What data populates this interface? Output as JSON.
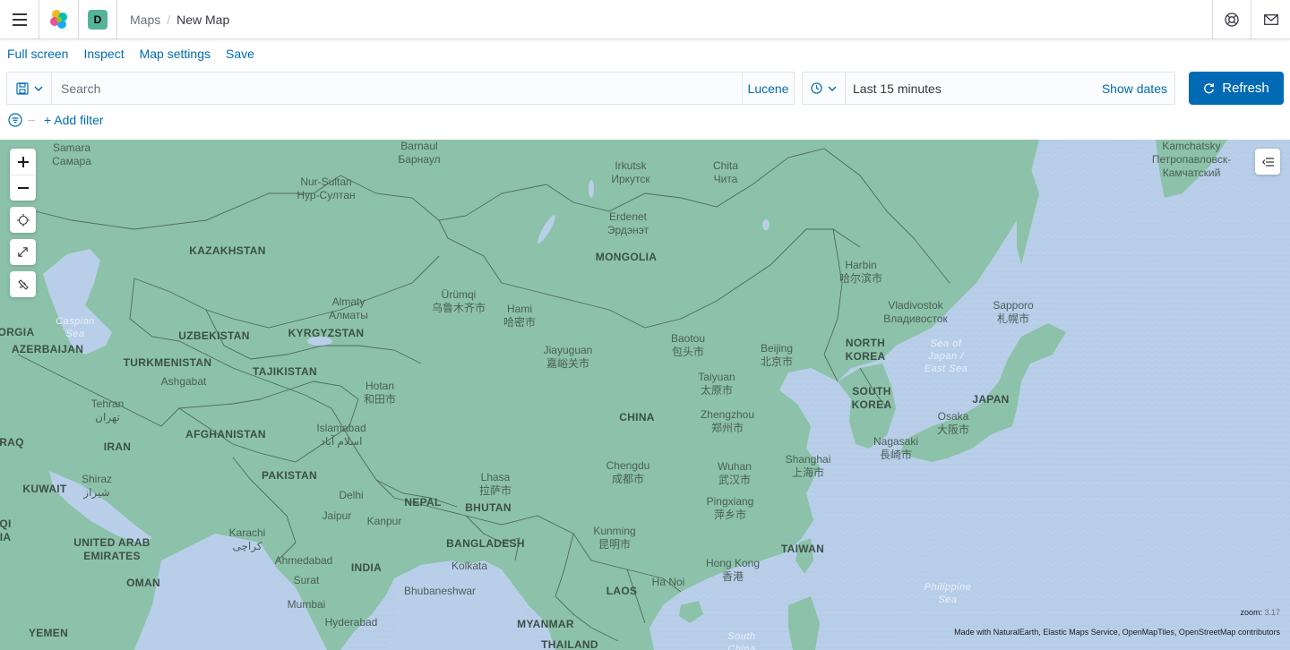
{
  "header": {
    "space_initial": "D",
    "breadcrumbs": [
      "Maps",
      "New Map"
    ]
  },
  "topnav": [
    "Full screen",
    "Inspect",
    "Map settings",
    "Save"
  ],
  "query": {
    "placeholder": "Search",
    "language": "Lucene"
  },
  "date": {
    "range": "Last 15 minutes",
    "show_dates": "Show dates",
    "refresh": "Refresh"
  },
  "filter": {
    "add": "+ Add filter"
  },
  "map": {
    "zoom_label": "zoom:",
    "zoom_value": "3.17",
    "attribution": "Made with NaturalEarth, Elastic Maps Service, OpenMapTiles, OpenStreetMap contributors",
    "colors": {
      "land": "#8cc2a9",
      "water": "#b9cfe9",
      "border": "#4e6a5e"
    },
    "labels": [
      {
        "text": "Samara\nСамара",
        "kind": "city"
      },
      {
        "text": "Barnaul\nБарнаул",
        "kind": "city"
      },
      {
        "text": "Irkutsk\nИркутск",
        "kind": "city"
      },
      {
        "text": "Chita\nЧита",
        "kind": "city"
      },
      {
        "text": "Kamchatsky\nПетропавловск-\nКамчатский",
        "kind": "city"
      },
      {
        "text": "Nur-Sultan\nНур-Султан",
        "kind": "city"
      },
      {
        "text": "Erdenet\nЭрдэнэт",
        "kind": "city"
      },
      {
        "text": "KAZAKHSTAN",
        "kind": "country"
      },
      {
        "text": "MONGOLIA",
        "kind": "country"
      },
      {
        "text": "Harbin\n哈尔滨市",
        "kind": "city"
      },
      {
        "text": "Ürümqi\n乌鲁木齐市",
        "kind": "city"
      },
      {
        "text": "Hami\n哈密市",
        "kind": "city"
      },
      {
        "text": "Almaty\nАлматы",
        "kind": "city"
      },
      {
        "text": "Vladivostok\nВладивосток",
        "kind": "city"
      },
      {
        "text": "Sapporo\n札幌市",
        "kind": "city"
      },
      {
        "text": "Caspian\nSea",
        "kind": "sea"
      },
      {
        "text": "ORGIA",
        "kind": "country"
      },
      {
        "text": "AZERBAIJAN",
        "kind": "country"
      },
      {
        "text": "UZBEKISTAN",
        "kind": "country"
      },
      {
        "text": "KYRGYZSTAN",
        "kind": "country"
      },
      {
        "text": "Baotou\n包头市",
        "kind": "city"
      },
      {
        "text": "Beijing\n北京市",
        "kind": "city"
      },
      {
        "text": "NORTH\nKOREA",
        "kind": "country"
      },
      {
        "text": "Sea of\nJapan /\nEast Sea",
        "kind": "sea"
      },
      {
        "text": "TURKMENISTAN",
        "kind": "country"
      },
      {
        "text": "TAJIKISTAN",
        "kind": "country"
      },
      {
        "text": "Jiayuguan\n嘉峪关市",
        "kind": "city"
      },
      {
        "text": "Ashgabat",
        "kind": "city"
      },
      {
        "text": "Taiyuan\n太原市",
        "kind": "city"
      },
      {
        "text": "SOUTH\nKOREA",
        "kind": "country"
      },
      {
        "text": "JAPAN",
        "kind": "country"
      },
      {
        "text": "Hotan\n和田市",
        "kind": "city"
      },
      {
        "text": "Tehran\nتهران",
        "kind": "city"
      },
      {
        "text": "CHINA",
        "kind": "country"
      },
      {
        "text": "Zhengzhou\n郑州市",
        "kind": "city"
      },
      {
        "text": "Osaka\n大阪市",
        "kind": "city"
      },
      {
        "text": "IRAN",
        "kind": "country"
      },
      {
        "text": "AFGHANISTAN",
        "kind": "country"
      },
      {
        "text": "Islamabad\nاسلام آباد",
        "kind": "city"
      },
      {
        "text": "RAQ",
        "kind": "country"
      },
      {
        "text": "Nagasaki\n長崎市",
        "kind": "city"
      },
      {
        "text": "Shanghai\n上海市",
        "kind": "city"
      },
      {
        "text": "Chengdu\n成都市",
        "kind": "city"
      },
      {
        "text": "Wuhan\n武汉市",
        "kind": "city"
      },
      {
        "text": "PAKISTAN",
        "kind": "country"
      },
      {
        "text": "Lhasa\n拉萨市",
        "kind": "city"
      },
      {
        "text": "Shiraz\nشیراز",
        "kind": "city"
      },
      {
        "text": "KUWAIT",
        "kind": "country"
      },
      {
        "text": "Delhi",
        "kind": "city"
      },
      {
        "text": "NEPAL",
        "kind": "country"
      },
      {
        "text": "BHUTAN",
        "kind": "country"
      },
      {
        "text": "Pingxiang\n萍乡市",
        "kind": "city"
      },
      {
        "text": "Jaipur",
        "kind": "city"
      },
      {
        "text": "Kanpur",
        "kind": "city"
      },
      {
        "text": "QI\nIA",
        "kind": "country"
      },
      {
        "text": "Karachi\nکراچی",
        "kind": "city"
      },
      {
        "text": "Kunming\n昆明市",
        "kind": "city"
      },
      {
        "text": "UNITED ARAB\nEMIRATES",
        "kind": "country"
      },
      {
        "text": "BANGLADESH",
        "kind": "country"
      },
      {
        "text": "TAIWAN",
        "kind": "country"
      },
      {
        "text": "Ahmedabad",
        "kind": "city"
      },
      {
        "text": "Kolkata",
        "kind": "city"
      },
      {
        "text": "INDIA",
        "kind": "country"
      },
      {
        "text": "Hong Kong\n香港",
        "kind": "city"
      },
      {
        "text": "Surat",
        "kind": "city"
      },
      {
        "text": "OMAN",
        "kind": "country"
      },
      {
        "text": "Ha Noi",
        "kind": "city"
      },
      {
        "text": "Philippine\nSea",
        "kind": "sea"
      },
      {
        "text": "Bhubaneshwar",
        "kind": "city"
      },
      {
        "text": "LAOS",
        "kind": "country"
      },
      {
        "text": "Mumbai",
        "kind": "city"
      },
      {
        "text": "Hyderabad",
        "kind": "city"
      },
      {
        "text": "MYANMAR",
        "kind": "country"
      },
      {
        "text": "YEMEN",
        "kind": "country"
      },
      {
        "text": "THAILAND",
        "kind": "country"
      },
      {
        "text": "South\nChina",
        "kind": "sea"
      }
    ]
  }
}
